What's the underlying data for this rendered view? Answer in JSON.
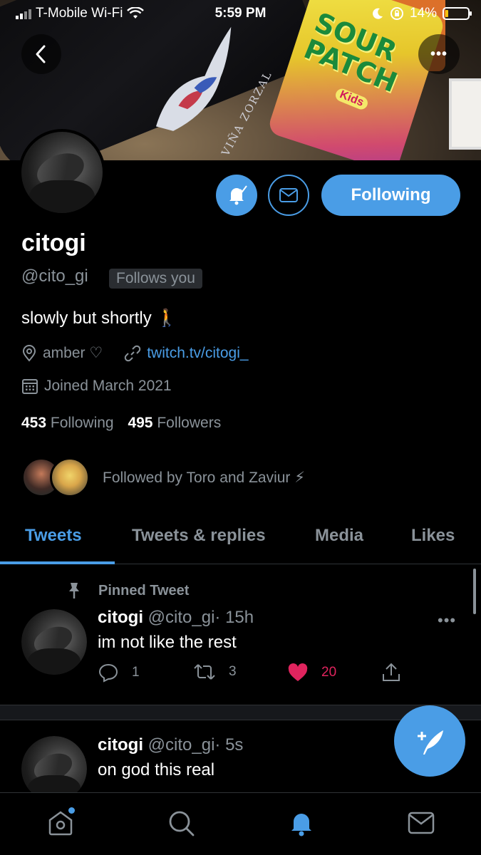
{
  "status_bar": {
    "carrier": "T-Mobile Wi-Fi",
    "time": "5:59 PM",
    "battery": "14%",
    "battery_level": 0.14
  },
  "banner": {
    "bottle_label": "VIÑA ZORZAL",
    "candy_brand": "SOUR PATCH",
    "candy_sub": "Kids"
  },
  "profile": {
    "name": "citogi",
    "handle": "@cito_gi",
    "follows_you": "Follows you",
    "bio": "slowly but shortly 🚶",
    "location": "amber ♡",
    "website": "twitch.tv/citogi_",
    "joined": "Joined March 2021",
    "following_count": "453",
    "following_label": "Following",
    "followers_count": "495",
    "followers_label": "Followers",
    "followed_by": "Followed by Toro and Zaviur ⚡"
  },
  "actions": {
    "follow_label": "Following"
  },
  "tabs": [
    {
      "label": "Tweets",
      "active": true
    },
    {
      "label": "Tweets & replies",
      "active": false
    },
    {
      "label": "Media",
      "active": false
    },
    {
      "label": "Likes",
      "active": false
    }
  ],
  "tweets": [
    {
      "pinned_label": "Pinned Tweet",
      "name": "citogi",
      "handle": "@cito_gi",
      "time": "· 15h",
      "text": "im not like the rest",
      "replies": "1",
      "retweets": "3",
      "likes": "20"
    },
    {
      "name": "citogi",
      "handle": "@cito_gi",
      "time": "· 5s",
      "text": "on god this real"
    }
  ],
  "colors": {
    "accent": "#4a9de6",
    "like": "#e0245e",
    "muted": "#8a9299",
    "background": "#000000"
  }
}
